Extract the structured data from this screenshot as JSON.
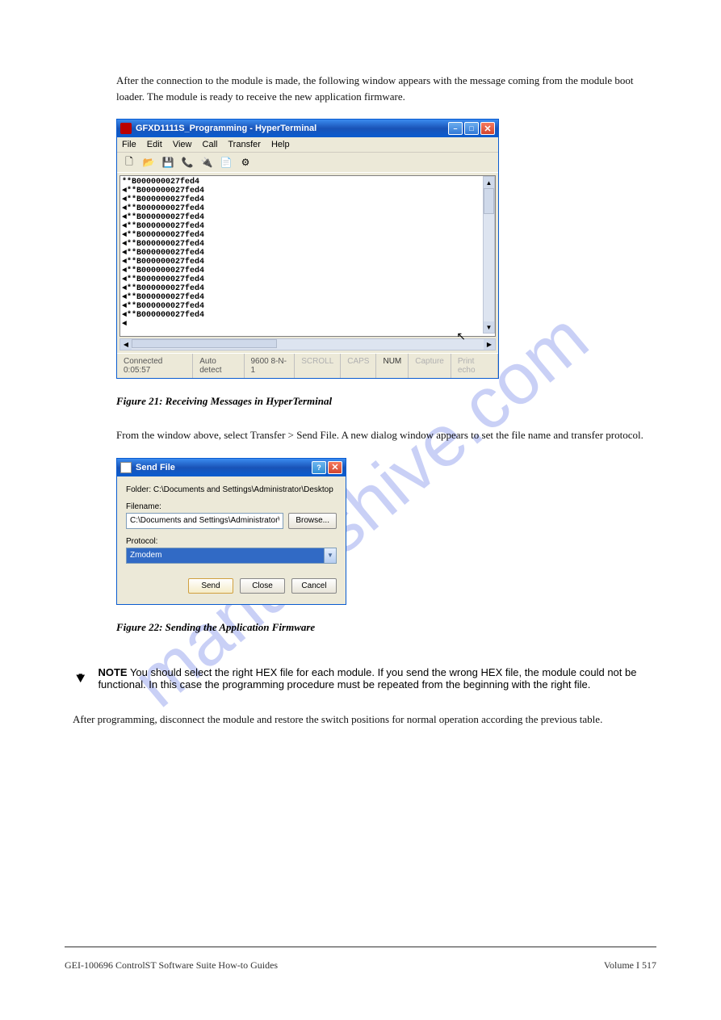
{
  "watermark": "manualshive.com",
  "intro_text": "After the connection to the module is made, the following window appears with the message coming from the module boot loader. The module is ready to receive the new application firmware.",
  "win1": {
    "title": "GFXD1111S_Programming - HyperTerminal",
    "menu": {
      "file": "File",
      "edit": "Edit",
      "view": "View",
      "call": "Call",
      "transfer": "Transfer",
      "help": "Help"
    },
    "term_lines": "**B000000027fed4\n◄**B000000027fed4\n◄**B000000027fed4\n◄**B000000027fed4\n◄**B000000027fed4\n◄**B000000027fed4\n◄**B000000027fed4\n◄**B000000027fed4\n◄**B000000027fed4\n◄**B000000027fed4\n◄**B000000027fed4\n◄**B000000027fed4\n◄**B000000027fed4\n◄**B000000027fed4\n◄**B000000027fed4\n◄**B000000027fed4\n◄",
    "status": {
      "connected": "Connected 0:05:57",
      "autodetect": "Auto detect",
      "baud": "9600 8-N-1",
      "scroll": "SCROLL",
      "caps": "CAPS",
      "num": "NUM",
      "capture": "Capture",
      "printecho": "Print echo"
    }
  },
  "caption1": "Figure 21: Receiving Messages in HyperTerminal",
  "step_text": "From the window above, select Transfer > Send File. A new dialog window appears to set the file name and transfer protocol.",
  "dlg": {
    "title": "Send File",
    "folder_label": "Folder:",
    "folder_path": "C:\\Documents and Settings\\Administrator\\Desktop",
    "filename_label": "Filename:",
    "filename_value": "C:\\Documents and Settings\\Administrator\\Deskto",
    "browse": "Browse...",
    "protocol_label": "Protocol:",
    "protocol_value": "Zmodem",
    "send": "Send",
    "close": "Close",
    "cancel": "Cancel"
  },
  "caption2": "Figure 22: Sending the Application Firmware",
  "note_label": "NOTE",
  "note_text": "You should select the right HEX file for each module. If you send the wrong HEX file, the module could not be functional. In this case the programming procedure must be repeated from the beginning with the right file.",
  "outro_text": "After programming, disconnect the module and restore the switch positions for normal operation according the previous table.",
  "footer": {
    "docnum": "GEI-100696 ControlST Software Suite How-to Guides",
    "page": "Volume I       517"
  }
}
